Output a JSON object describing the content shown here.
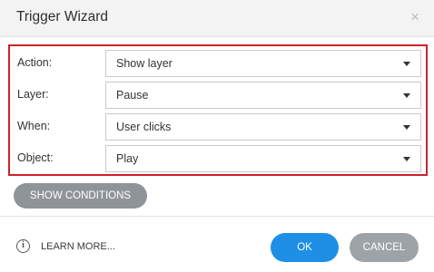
{
  "dialog": {
    "title": "Trigger Wizard",
    "close_glyph": "×"
  },
  "fields": [
    {
      "label": "Action:",
      "value": "Show layer"
    },
    {
      "label": "Layer:",
      "value": "Pause"
    },
    {
      "label": "When:",
      "value": "User clicks"
    },
    {
      "label": "Object:",
      "value": "Play"
    }
  ],
  "buttons": {
    "show_conditions": "SHOW CONDITIONS",
    "learn_more": "LEARN MORE...",
    "ok": "OK",
    "cancel": "CANCEL"
  },
  "icons": {
    "info": "info-icon",
    "close": "close-icon",
    "dropdown": "chevron-down-icon"
  },
  "colors": {
    "highlight_border": "#cc2229",
    "primary": "#1f8fe5",
    "secondary": "#9ea3a8",
    "show_conditions_bg": "#8f9499"
  }
}
